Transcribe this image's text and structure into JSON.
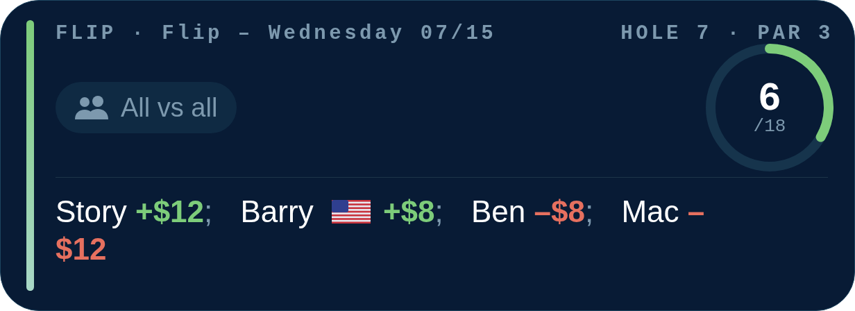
{
  "header": {
    "game": "FLIP · Flip – Wednesday 07/15",
    "hole": "HOLE 7 · PAR 3"
  },
  "format": {
    "label": "All vs all"
  },
  "progress": {
    "current": "6",
    "total": "/18"
  },
  "results": [
    {
      "name": "Story",
      "flag": false,
      "amount": "+$12",
      "color": "#7dcc7a",
      "separator": ";"
    },
    {
      "name": "Barry",
      "flag": true,
      "amount": "+$8",
      "color": "#7dcc7a",
      "separator": ";"
    },
    {
      "name": "Ben",
      "flag": false,
      "amount": "–$8",
      "color": "#e6705f",
      "separator": ";"
    },
    {
      "name": "Mac",
      "flag": false,
      "amount": "–$12",
      "color": "#e6705f"
    }
  ]
}
